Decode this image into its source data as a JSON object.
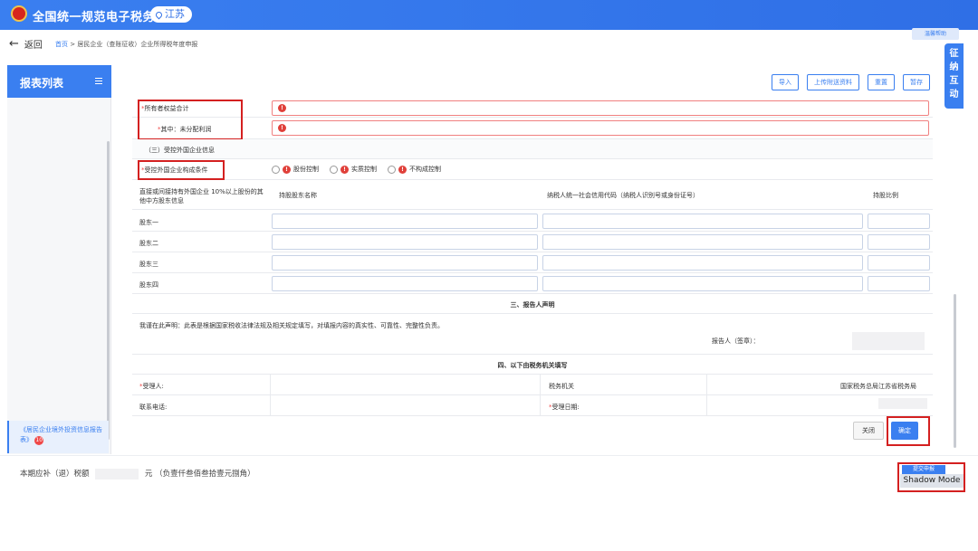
{
  "header": {
    "app_title": "全国统一规范电子税务局",
    "region": "江苏"
  },
  "nav": {
    "back_label": "返回",
    "breadcrumb_home": "首页",
    "breadcrumb_sep": ">",
    "breadcrumb_current": "居民企业（查账征收）企业所得税年度申报",
    "feedback_label": "温馨帮助",
    "side_tab_label": "征纳互动"
  },
  "sidebar": {
    "title": "报表列表",
    "active_item": "《居民企业境外投资信息报告表》",
    "active_badge": "10"
  },
  "toolbar": {
    "import": "导入",
    "upload": "上传附送资料",
    "reset": "重置",
    "save_draft": "暂存"
  },
  "form": {
    "owner_equity_label": "所有者权益合计",
    "undistributed_profit_label": "其中：未分配利润",
    "section3_title": "（三）受控外国企业信息",
    "cfc_condition_label": "受控外国企业构成条件",
    "cfc_options": [
      "股份控制",
      "实质控制",
      "不构成控制"
    ],
    "shareholder_desc": "直接或间接持有外国企业 10%以上股份的其他中方股东信息",
    "col_name": "持股股东名称",
    "col_taxid": "纳税人统一社会信用代码（纳税人识别号或身份证号）",
    "col_ratio": "持股比例",
    "shareholders": [
      "股东一",
      "股东二",
      "股东三",
      "股东四"
    ],
    "declaration_title": "三、报告人声明",
    "declaration_text": "我谨在此声明：此表是根据国家税收法律法规及相关规定填写，对填报内容的真实性、可靠性、完整性负责。",
    "signer_label": "报告人（签章）：",
    "tax_office_title": "四、以下由税务机关填写",
    "acceptor_label": "受理人:",
    "tax_authority_label": "税务机关",
    "tax_authority_value": "国家税务总局江苏省税务局",
    "phone_label": "联系电话:",
    "accept_date_label": "受理日期:"
  },
  "dialog_buttons": {
    "close": "关闭",
    "confirm": "确定"
  },
  "footer": {
    "tax_label": "本期应补（退）税额",
    "unit": "元",
    "amount_words": "（负壹仟叁佰叁拾壹元捌角）",
    "submit": "提交申报",
    "shadow_mode": "Shadow Mode"
  }
}
